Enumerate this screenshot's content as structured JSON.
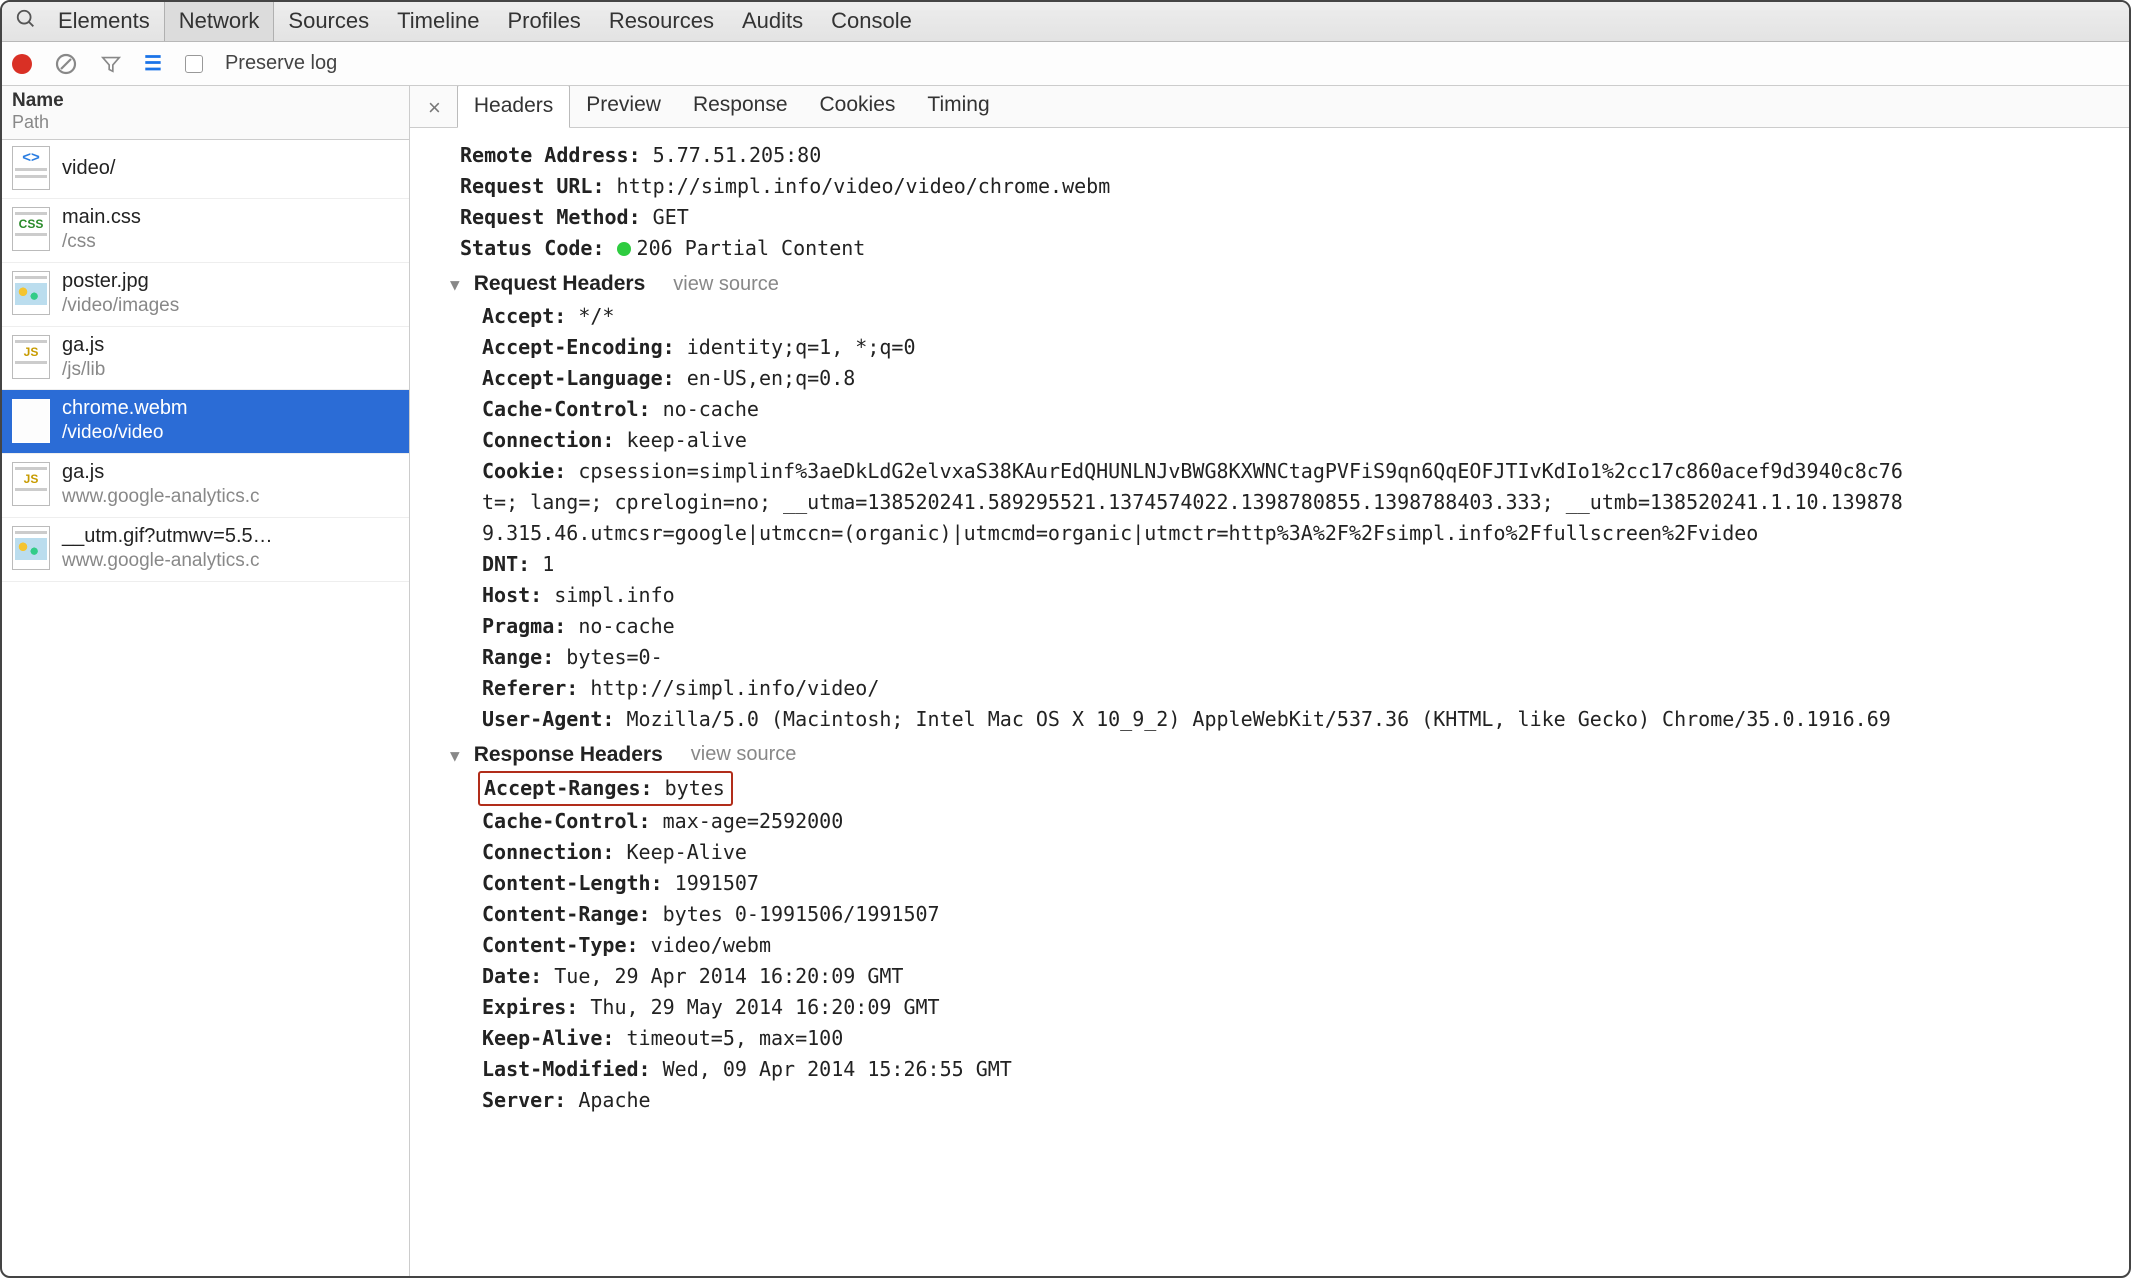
{
  "tabs": [
    "Elements",
    "Network",
    "Sources",
    "Timeline",
    "Profiles",
    "Resources",
    "Audits",
    "Console"
  ],
  "activeTab": "Network",
  "toolbar": {
    "preserve_log": "Preserve log"
  },
  "sidebar": {
    "header": {
      "name": "Name",
      "path": "Path"
    },
    "items": [
      {
        "name": "video/",
        "path": "",
        "type": "html"
      },
      {
        "name": "main.css",
        "path": "/css",
        "type": "css"
      },
      {
        "name": "poster.jpg",
        "path": "/video/images",
        "type": "img"
      },
      {
        "name": "ga.js",
        "path": "/js/lib",
        "type": "js"
      },
      {
        "name": "chrome.webm",
        "path": "/video/video",
        "type": "media",
        "selected": true
      },
      {
        "name": "ga.js",
        "path": "www.google-analytics.c",
        "type": "js"
      },
      {
        "name": "__utm.gif?utmwv=5.5…",
        "path": "www.google-analytics.c",
        "type": "img"
      }
    ]
  },
  "detailsTabs": [
    "Headers",
    "Preview",
    "Response",
    "Cookies",
    "Timing"
  ],
  "activeDetailsTab": "Headers",
  "general": {
    "remote_label": "Remote Address:",
    "remote_value": "5.77.51.205:80",
    "url_label": "Request URL:",
    "url_value": "http://simpl.info/video/video/chrome.webm",
    "method_label": "Request Method:",
    "method_value": "GET",
    "status_label": "Status Code:",
    "status_value": "206 Partial Content"
  },
  "sections": {
    "request_title": "Request Headers",
    "response_title": "Response Headers",
    "view_source": "view source"
  },
  "request_headers": [
    {
      "k": "Accept:",
      "v": "*/*"
    },
    {
      "k": "Accept-Encoding:",
      "v": "identity;q=1, *;q=0"
    },
    {
      "k": "Accept-Language:",
      "v": "en-US,en;q=0.8"
    },
    {
      "k": "Cache-Control:",
      "v": "no-cache"
    },
    {
      "k": "Connection:",
      "v": "keep-alive"
    },
    {
      "k": "Cookie:",
      "v": "cpsession=simplinf%3aeDkLdG2elvxaS38KAurEdQHUNLNJvBWG8KXWNCtagPVFiS9qn6QqEOFJTIvKdIo1%2cc17c860acef9d3940c8c76"
    },
    {
      "k": "",
      "v": "t=; lang=; cprelogin=no; __utma=138520241.589295521.1374574022.1398780855.1398788403.333; __utmb=138520241.1.10.139878"
    },
    {
      "k": "",
      "v": "9.315.46.utmcsr=google|utmccn=(organic)|utmcmd=organic|utmctr=http%3A%2F%2Fsimpl.info%2Ffullscreen%2Fvideo"
    },
    {
      "k": "DNT:",
      "v": "1"
    },
    {
      "k": "Host:",
      "v": "simpl.info"
    },
    {
      "k": "Pragma:",
      "v": "no-cache"
    },
    {
      "k": "Range:",
      "v": "bytes=0-"
    },
    {
      "k": "Referer:",
      "v": "http://simpl.info/video/"
    },
    {
      "k": "User-Agent:",
      "v": "Mozilla/5.0 (Macintosh; Intel Mac OS X 10_9_2) AppleWebKit/537.36 (KHTML, like Gecko) Chrome/35.0.1916.69"
    }
  ],
  "response_headers": [
    {
      "k": "Accept-Ranges:",
      "v": "bytes",
      "highlight": true
    },
    {
      "k": "Cache-Control:",
      "v": "max-age=2592000"
    },
    {
      "k": "Connection:",
      "v": "Keep-Alive"
    },
    {
      "k": "Content-Length:",
      "v": "1991507"
    },
    {
      "k": "Content-Range:",
      "v": "bytes 0-1991506/1991507"
    },
    {
      "k": "Content-Type:",
      "v": "video/webm"
    },
    {
      "k": "Date:",
      "v": "Tue, 29 Apr 2014 16:20:09 GMT"
    },
    {
      "k": "Expires:",
      "v": "Thu, 29 May 2014 16:20:09 GMT"
    },
    {
      "k": "Keep-Alive:",
      "v": "timeout=5, max=100"
    },
    {
      "k": "Last-Modified:",
      "v": "Wed, 09 Apr 2014 15:26:55 GMT"
    },
    {
      "k": "Server:",
      "v": "Apache"
    }
  ]
}
